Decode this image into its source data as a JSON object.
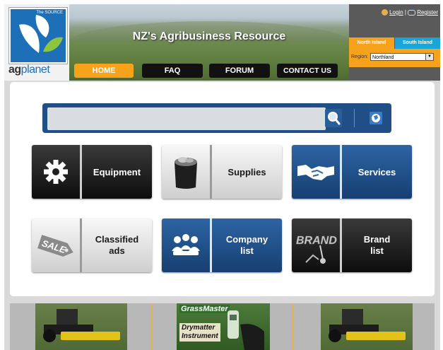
{
  "header": {
    "logo": {
      "tagline": "The SOURCE",
      "brand_ag": "ag",
      "brand_planet": "planet"
    },
    "banner_title": "NZ's Agribusiness Resource",
    "nav": [
      {
        "label": "HOME",
        "active": true
      },
      {
        "label": "FAQ"
      },
      {
        "label": "FORUM"
      },
      {
        "label": "CONTACT US"
      }
    ],
    "auth": {
      "login": "Login",
      "separator": "|",
      "register": "Register"
    },
    "islands": {
      "north": "North Island",
      "south": "South Island",
      "selected": "North Island"
    },
    "region": {
      "label": "Region:",
      "value": "Northland"
    }
  },
  "search": {
    "placeholder": "",
    "value": "",
    "search_icon": "magnifier-icon",
    "globe_icon": "globe-icon"
  },
  "tiles": [
    {
      "label": "Equipment",
      "icon": "gear-icon",
      "style": "dark"
    },
    {
      "label": "Supplies",
      "icon": "sack-icon",
      "style": "light"
    },
    {
      "label": "Services",
      "icon": "handshake-icon",
      "style": "blue"
    },
    {
      "label": "Classified ads",
      "icon": "sale-tag-icon",
      "style": "light"
    },
    {
      "label": "Company list",
      "icon": "meeting-icon",
      "style": "blue"
    },
    {
      "label": "Brand list",
      "icon": "brand-icon",
      "style": "dark"
    }
  ],
  "ads": {
    "middle_title": "GrassMaster",
    "middle_subtitle_1": "Drymatter",
    "middle_subtitle_2": "Instrument"
  },
  "colors": {
    "orange": "#f7a21b",
    "navy": "#1f4f86",
    "blue_tile": "#2d64a3",
    "dark_tile": "#111111",
    "south_tab": "#1aa5d8"
  }
}
